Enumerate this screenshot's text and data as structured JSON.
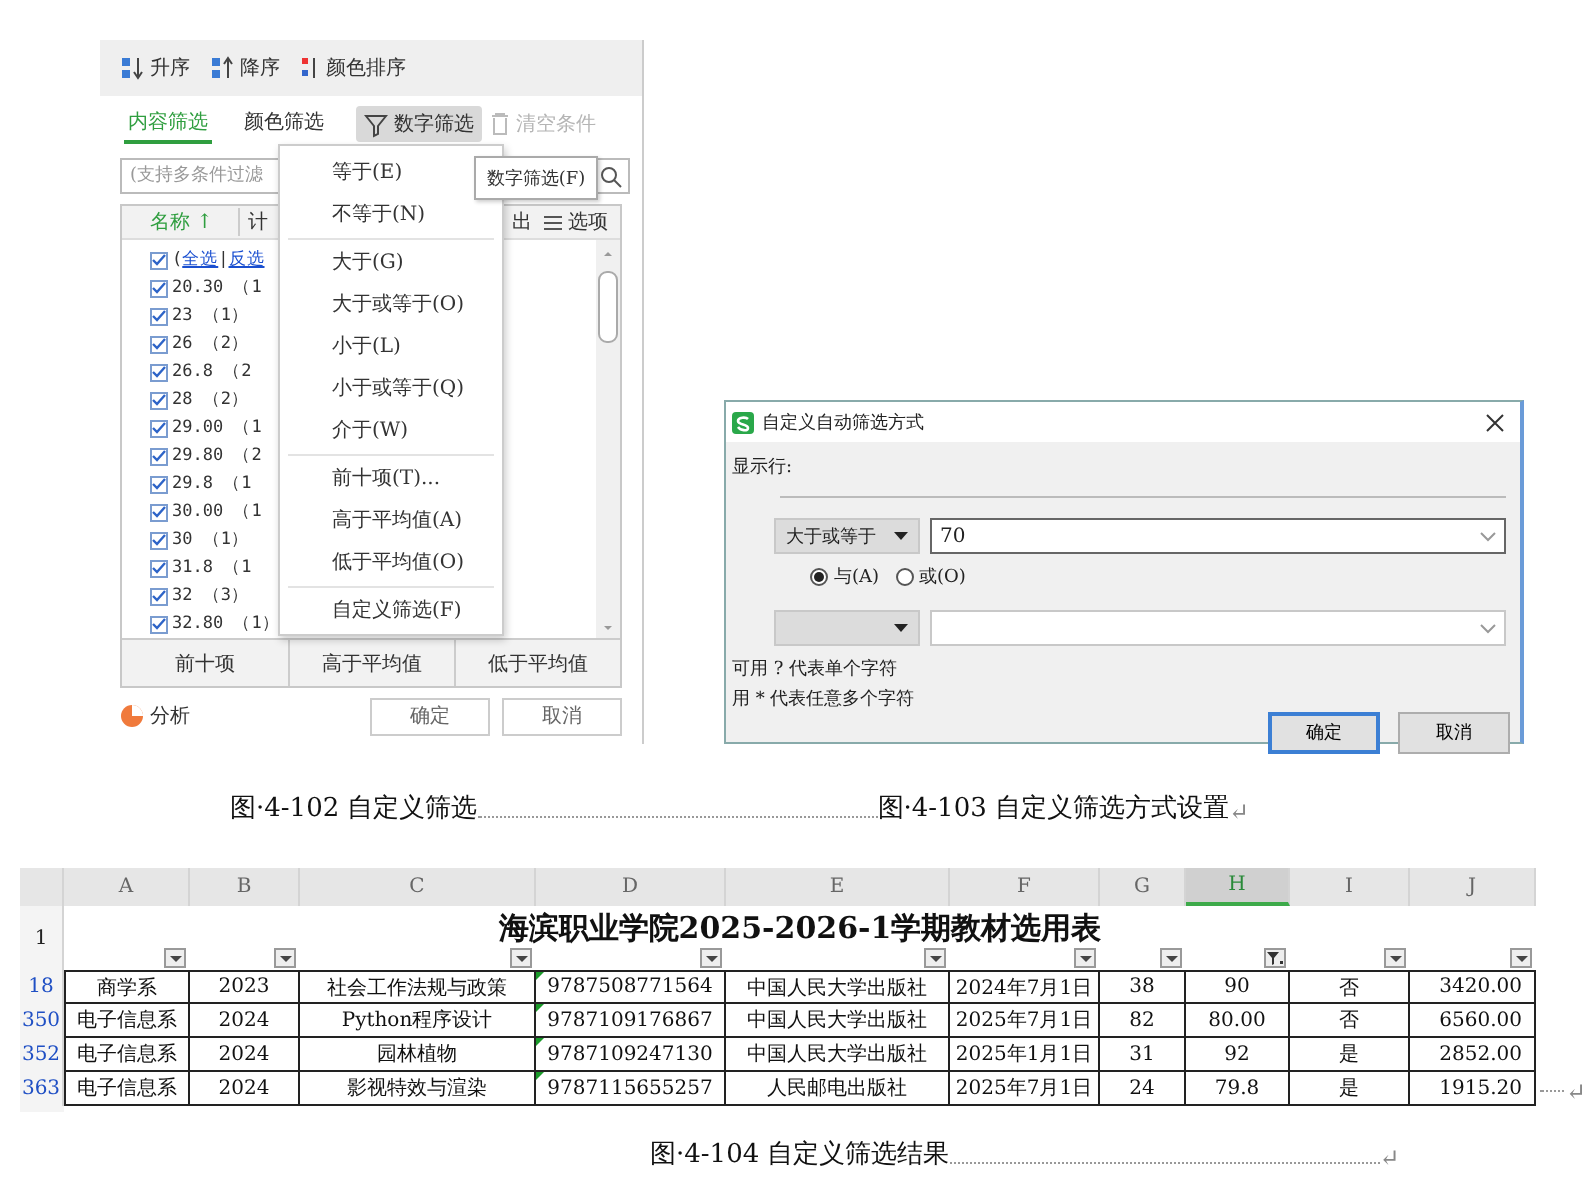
{
  "filter_panel": {
    "sort_buttons": [
      {
        "label": "升序",
        "kind": "ascending"
      },
      {
        "label": "降序",
        "kind": "descending"
      },
      {
        "label": "颜色排序",
        "kind": "color"
      }
    ],
    "tabs": [
      {
        "label": "内容筛选",
        "selected": true
      },
      {
        "label": "颜色筛选",
        "selected": false
      }
    ],
    "number_filter": {
      "label": "数字筛选",
      "active": true
    },
    "clear_button": {
      "label": "清空条件",
      "disabled": true
    },
    "search": {
      "placeholder": "(支持多条件过滤"
    },
    "list_header": {
      "name": "名称 ↑",
      "column_2": "计",
      "column_3": "出",
      "options": "选项"
    },
    "select_all": {
      "checked": true,
      "prefix": "(",
      "all": "全选",
      "separator": "|",
      "invert": "反选"
    },
    "items": [
      {
        "label": "20.30 （1",
        "checked": true
      },
      {
        "label": "23 （1）",
        "checked": true
      },
      {
        "label": "26 （2）",
        "checked": true
      },
      {
        "label": "26.8 （2",
        "checked": true
      },
      {
        "label": "28 （2）",
        "checked": true
      },
      {
        "label": "29.00 （1",
        "checked": true
      },
      {
        "label": "29.80 （2",
        "checked": true
      },
      {
        "label": "29.8 （1",
        "checked": true
      },
      {
        "label": "30.00 （1",
        "checked": true
      },
      {
        "label": "30 （1）",
        "checked": true
      },
      {
        "label": "31.8 （1",
        "checked": true
      },
      {
        "label": "32 （3）",
        "checked": true
      },
      {
        "label": "32.80 （1）",
        "checked": true
      }
    ],
    "quick_buttons": [
      "前十项",
      "高于平均值",
      "低于平均值"
    ],
    "analysis": "分析",
    "ok": "确定",
    "cancel": "取消"
  },
  "number_menu": [
    {
      "label": "等于(E)",
      "separator_before": false
    },
    {
      "label": "不等于(N)",
      "separator_before": false
    },
    {
      "label": "大于(G)",
      "separator_before": true
    },
    {
      "label": "大于或等于(O)",
      "separator_before": false
    },
    {
      "label": "小于(L)",
      "separator_before": false
    },
    {
      "label": "小于或等于(Q)",
      "separator_before": false
    },
    {
      "label": "介于(W)",
      "separator_before": false
    },
    {
      "label": "前十项(T)...",
      "separator_before": true
    },
    {
      "label": "高于平均值(A)",
      "separator_before": false
    },
    {
      "label": "低于平均值(O)",
      "separator_before": false
    },
    {
      "label": "自定义筛选(F)",
      "separator_before": true
    }
  ],
  "tooltip": "数字筛选(F)",
  "dialog": {
    "title": "自定义自动筛选方式",
    "label": "显示行:",
    "conditions": [
      {
        "operator": "大于或等于",
        "value": "70",
        "focused": true
      },
      {
        "focused": false
      }
    ],
    "join": [
      {
        "label": "与(A)",
        "selected": true
      },
      {
        "label": "或(O)",
        "selected": false
      }
    ],
    "hints": [
      "可用 ? 代表单个字符",
      "用 * 代表任意多个字符"
    ],
    "buttons": [
      {
        "label": "确定",
        "default": true
      },
      {
        "label": "取消",
        "default": false
      }
    ]
  },
  "captions_top": [
    "图·4-102 自定义筛选",
    "图·4-103 自定义筛选方式设置"
  ],
  "paragraph_mark": "↵",
  "sheet": {
    "columns": [
      {
        "letter": "A",
        "selected": false,
        "filtered": false
      },
      {
        "letter": "B",
        "selected": false,
        "filtered": false
      },
      {
        "letter": "C",
        "selected": false,
        "filtered": false
      },
      {
        "letter": "D",
        "selected": false,
        "filtered": false
      },
      {
        "letter": "E",
        "selected": false,
        "filtered": false
      },
      {
        "letter": "F",
        "selected": false,
        "filtered": false
      },
      {
        "letter": "G",
        "selected": false,
        "filtered": false
      },
      {
        "letter": "H",
        "selected": true,
        "filtered": true
      },
      {
        "letter": "I",
        "selected": false,
        "filtered": false
      },
      {
        "letter": "J",
        "selected": false,
        "filtered": false
      }
    ],
    "title_row": {
      "number": "1",
      "title": "海滨职业学院2025-2026-1学期教材选用表"
    },
    "rows": [
      {
        "number": "18",
        "cells": [
          "商学系",
          "2023",
          "社会工作法规与政策",
          "9787508771564",
          "中国人民大学出版社",
          "2024年7月1日",
          "38",
          "90",
          "否",
          "3420.00"
        ]
      },
      {
        "number": "350",
        "cells": [
          "电子信息系",
          "2024",
          "Python程序设计",
          "9787109176867",
          "中国人民大学出版社",
          "2025年7月1日",
          "82",
          "80.00",
          "否",
          "6560.00"
        ]
      },
      {
        "number": "352",
        "cells": [
          "电子信息系",
          "2024",
          "园林植物",
          "9787109247130",
          "中国人民大学出版社",
          "2025年1月1日",
          "31",
          "92",
          "是",
          "2852.00"
        ]
      },
      {
        "number": "363",
        "cells": [
          "电子信息系",
          "2024",
          "影视特效与渲染",
          "9787115655257",
          "人民邮电出版社",
          "2025年7月1日",
          "24",
          "79.8",
          "是",
          "1915.20"
        ]
      }
    ]
  },
  "caption_bottom": "图·4-104 自定义筛选结果"
}
